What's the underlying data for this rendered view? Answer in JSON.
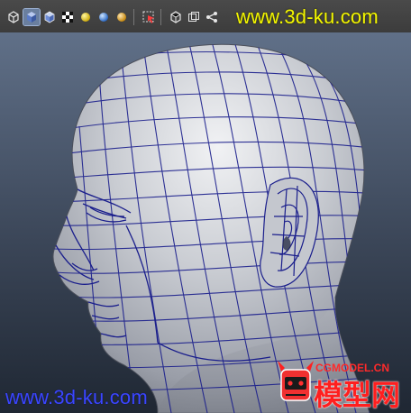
{
  "toolbar": {
    "icons": [
      "wireframe-cube-icon",
      "shaded-cube-icon",
      "smooth-shade-cube-icon",
      "checker-texture-icon",
      "default-light-icon",
      "all-lights-icon",
      "selected-light-icon",
      "select-camera-icon",
      "isolate-select-icon",
      "xray-icon",
      "share-icon"
    ]
  },
  "watermark": {
    "top_text": "www.3d-ku.com",
    "bottom_text": "www.3d-ku.com",
    "top_color": "#f3f600",
    "bottom_color": "#3b46ff"
  },
  "viewport": {
    "subject": "head-wireframe-model",
    "wire_color": "#1a1e8c",
    "surface_color": "#b9bcc4"
  },
  "logo": {
    "url": "CGMODEL.CN",
    "title": "模型网",
    "color": "#ff1f1f"
  }
}
